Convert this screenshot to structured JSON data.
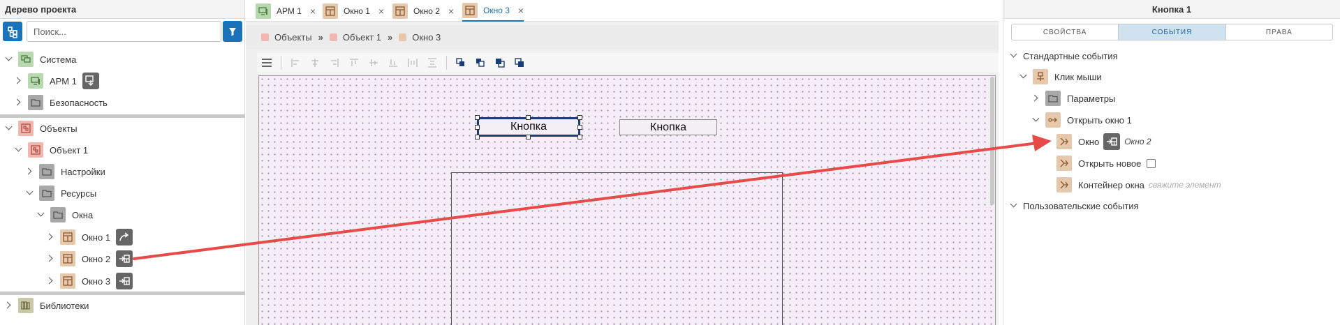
{
  "left_panel": {
    "title": "Дерево проекта",
    "search_placeholder": "Поиск...",
    "tree": {
      "system": "Система",
      "arm1": "АРМ 1",
      "security": "Безопасность",
      "objects": "Объекты",
      "object1": "Объект 1",
      "settings": "Настройки",
      "resources": "Ресурсы",
      "windows": "Окна",
      "window1": "Окно 1",
      "window2": "Окно 2",
      "window3": "Окно 3",
      "libraries": "Библиотеки"
    }
  },
  "tabs": [
    {
      "label": "АРМ 1",
      "close": "×"
    },
    {
      "label": "Окно 1",
      "close": "×"
    },
    {
      "label": "Окно 2",
      "close": "×"
    },
    {
      "label": "Окно 3",
      "close": "×"
    }
  ],
  "breadcrumb": {
    "items": [
      "Объекты",
      "Объект 1",
      "Окно 3"
    ],
    "separator": "»"
  },
  "canvas": {
    "button1": "Кнопка",
    "button2": "Кнопка"
  },
  "right_panel": {
    "title": "Кнопка 1",
    "tabs": [
      "СВОЙСТВА",
      "СОБЫТИЯ",
      "ПРАВА"
    ],
    "active_tab": "СОБЫТИЯ",
    "standard_events": "Стандартные события",
    "mouse_click": "Клик мыши",
    "params": "Параметры",
    "open_window": "Открыть окно 1",
    "window_label": "Окно",
    "window_value": "Окно 2",
    "open_new": "Открыть новое",
    "container": "Контейнер окна",
    "container_hint": "свяжите элемент",
    "user_events": "Пользовательские события"
  },
  "colors": {
    "accent": "#1a73b8",
    "arrow": "#e84a4a"
  }
}
